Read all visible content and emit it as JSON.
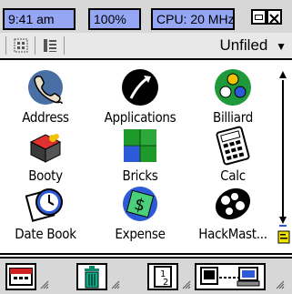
{
  "status_bar": {
    "time": "9:41 am",
    "battery": "100%",
    "cpu": "CPU: 20 MHz"
  },
  "toolbar": {
    "category_label": "Unfiled"
  },
  "apps": [
    {
      "label": "Address"
    },
    {
      "label": "Applications"
    },
    {
      "label": "Billiard"
    },
    {
      "label": "Booty"
    },
    {
      "label": "Bricks"
    },
    {
      "label": "Calc"
    },
    {
      "label": "Date Book"
    },
    {
      "label": "Expense"
    },
    {
      "label": "HackMast..."
    }
  ],
  "launcher": {
    "items": [
      {
        "icon": "calendar-icon"
      },
      {
        "icon": "trash-icon"
      },
      {
        "icon": "number-1-2-icon"
      },
      {
        "icon": "computer-sync-icon"
      }
    ]
  },
  "colors": {
    "status_pill": "#95a6f5",
    "bar_gray": "#d7d7d7"
  }
}
